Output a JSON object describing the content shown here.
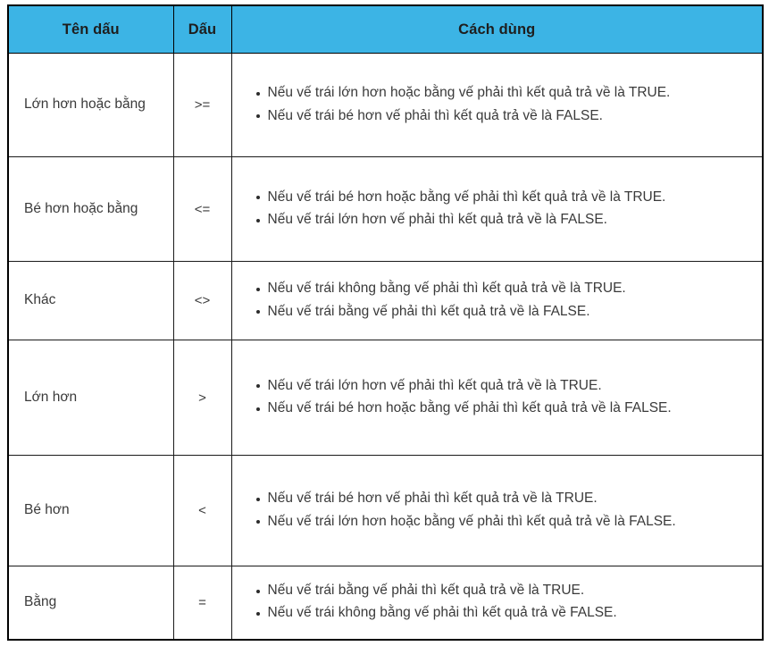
{
  "table": {
    "headers": [
      {
        "label": "Tên dấu",
        "key": "name"
      },
      {
        "label": "Dấu",
        "key": "sign"
      },
      {
        "label": "Cách dùng",
        "key": "usage"
      }
    ],
    "header_bg": "#3cb4e5",
    "header_text_color": "#1e1e1e",
    "border_color": "#1a1a1a",
    "body_text_color": "#3a3a3a",
    "rows": [
      {
        "name": "Lớn hơn hoặc bằng",
        "sign": ">=",
        "usage": [
          "Nếu vế trái lớn hơn hoặc bằng vế phải thì kết quả trả về là TRUE.",
          "Nếu vế trái bé hơn vế phải thì kết quả trả về là FALSE."
        ]
      },
      {
        "name": "Bé hơn hoặc bằng",
        "sign": "<=",
        "usage": [
          "Nếu vế trái bé hơn hoặc bằng vế phải thì kết quả trả về là TRUE.",
          "Nếu vế trái lớn hơn vế phải thì kết quả trả về là FALSE."
        ]
      },
      {
        "name": "Khác",
        "sign": "<>",
        "usage": [
          "Nếu vế trái không bằng vế phải thì kết quả trả về là TRUE.",
          "Nếu vế trái bằng vế phải thì kết quả trả về là FALSE."
        ]
      },
      {
        "name": "Lớn hơn",
        "sign": ">",
        "usage": [
          "Nếu vế trái lớn hơn vế phải thì kết quả trả về là TRUE.",
          "Nếu vế trái bé hơn hoặc bằng vế phải thì kết quả trả về là FALSE."
        ]
      },
      {
        "name": "Bé hơn",
        "sign": "<",
        "usage": [
          "Nếu vế trái bé hơn vế phải thì kết quả trả về là TRUE.",
          "Nếu vế trái lớn hơn hoặc bằng vế phải thì kết quả trả về là FALSE."
        ]
      },
      {
        "name": "Bằng",
        "sign": "=",
        "usage": [
          "Nếu vế trái bằng vế phải thì kết quả trả về là TRUE.",
          "Nếu vế trái không bằng vế phải thì kết quả trả về FALSE."
        ]
      }
    ]
  }
}
